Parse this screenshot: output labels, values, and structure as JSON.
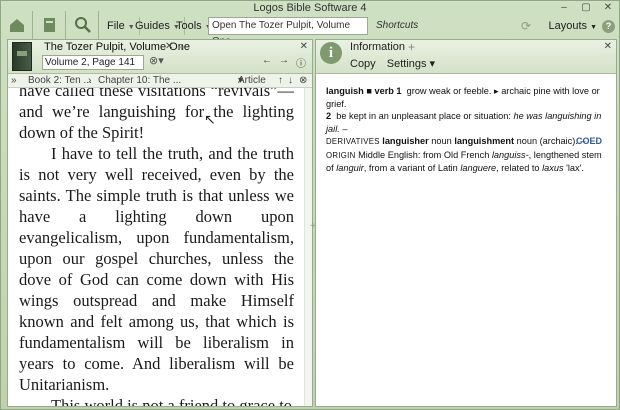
{
  "app": {
    "title": "Logos Bible Software 4",
    "window_controls": [
      "–",
      "▢",
      "✕"
    ]
  },
  "toolbar": {
    "menus": [
      "File",
      "Guides",
      "Tools"
    ],
    "go_box_value": "Open The Tozer Pulpit, Volume One",
    "shortcuts_label": "Shortcuts",
    "layouts_label": "Layouts",
    "help": "?"
  },
  "left_panel": {
    "tab_title": "The Tozer Pulpit, Volume One",
    "reference": "Volume 2, Page 141",
    "breadcrumb_1": "Book 2: Ten ...",
    "breadcrumb_2": "Chapter 10: The ...",
    "article_label": "Article",
    "para_1": "have called these visitations “revivals”—and we’re languishing for the lighting down of the Spirit!",
    "para_2": "I have to tell the truth, and the truth is not very well received, even by the saints. The simple truth is that unless we have a lighting down upon evangelicalism, upon fundamentalism, upon our gospel churches, unless the dove of God can come down with His wings outspread and make Himself known and felt among us, that which is fundamentalism will be liberalism in years to come. And liberalism will be Unitarianism.",
    "para_3": "This world is not a friend to grace to"
  },
  "right_panel": {
    "tab_title": "Information",
    "copy_label": "Copy",
    "settings_label": "Settings",
    "entry_word": "languish",
    "entry_pos": "verb 1",
    "def_1": "grow weak or feeble.",
    "def_1b": "archaic pine with love or grief.",
    "def_2_num": "2",
    "def_2": "be kept in an unpleasant place or situation:",
    "def_2_example": "he was languishing in jail.",
    "derivatives_label": "DERIVATIVES",
    "deriv_1": "languisher",
    "deriv_1_pos": "noun",
    "deriv_2": "languishment",
    "deriv_2_pos": "noun (archaic). –",
    "origin_label": "ORIGIN",
    "origin_text_a": "Middle English: from Old French",
    "origin_word": "languiss-",
    "origin_text_b": ", lengthened stem of",
    "origin_word2": "languir",
    "origin_text_c": ", from a variant of Latin",
    "origin_word3": "languere",
    "origin_text_d": ", related to",
    "origin_word4": "laxus",
    "origin_text_e": "'lax'.",
    "source": "COED"
  },
  "colors": {
    "frame": "#bed3ad",
    "panel_header": "#d4e2c8",
    "link": "#2c5aa0"
  }
}
